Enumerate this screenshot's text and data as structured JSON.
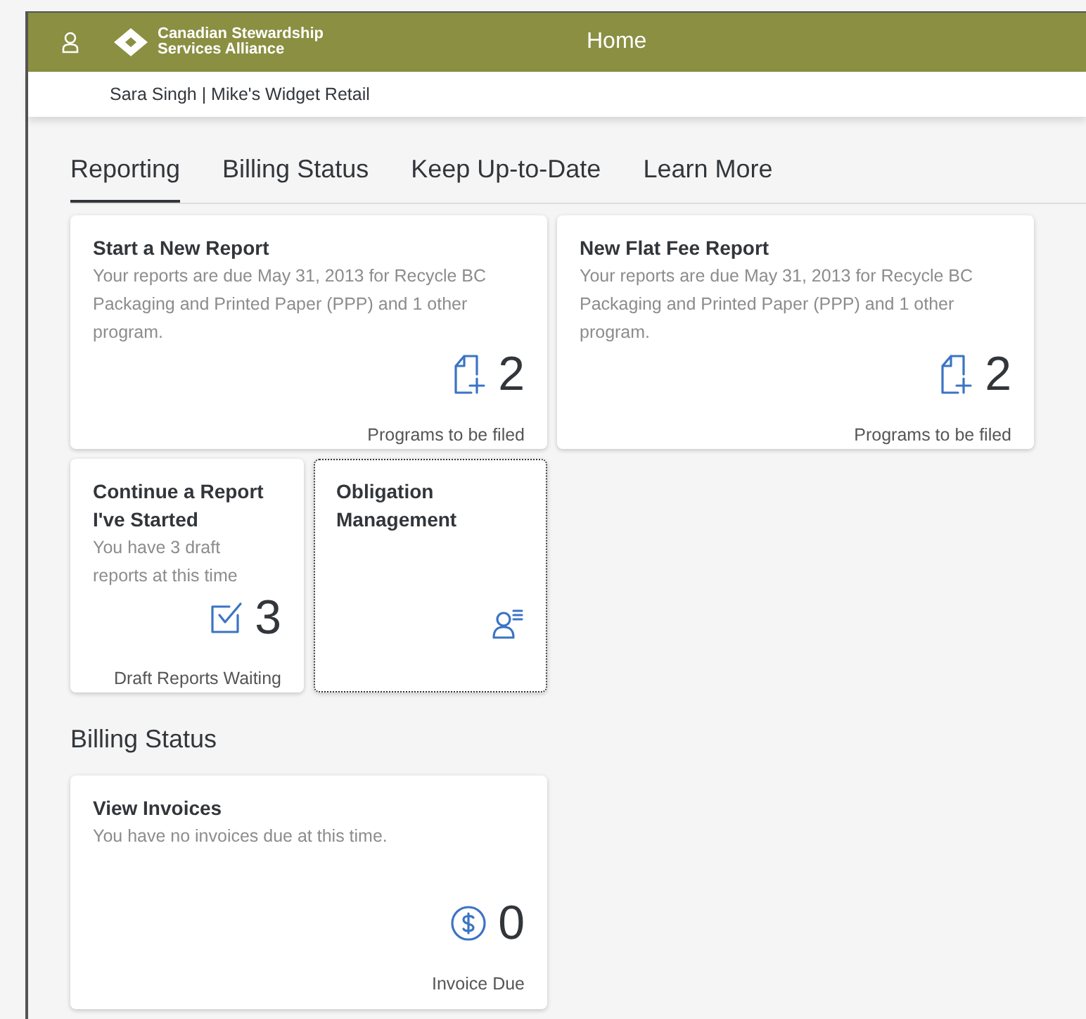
{
  "header": {
    "logo_lines": [
      "Canadian Stewardship",
      "Services Alliance"
    ],
    "title": "Home"
  },
  "user_bar": {
    "text": "Sara Singh | Mike's Widget Retail"
  },
  "tabs": [
    {
      "label": "Reporting",
      "selected": true
    },
    {
      "label": "Billing Status",
      "selected": false
    },
    {
      "label": "Keep Up-to-Date",
      "selected": false
    },
    {
      "label": "Learn More",
      "selected": false
    }
  ],
  "reporting_tiles": [
    {
      "kind": "document",
      "focused": false,
      "title": "Start a New Report",
      "subtitle": "Your reports are due May 31, 2013 for Recycle BC Packaging and Printed Paper (PPP) and 1 other program.",
      "value": "2",
      "footer": "Programs to be filed"
    },
    {
      "kind": "document",
      "focused": false,
      "title": "New Flat Fee Report",
      "subtitle": "Your reports are due May 31, 2013 for Recycle BC Packaging and Printed Paper (PPP) and 1 other program.",
      "value": "2",
      "footer": "Programs to be filed"
    },
    {
      "kind": "checklist",
      "focused": false,
      "title": "Continue a Report I've Started",
      "subtitle": "You have 3 draft reports at this time",
      "value": "3",
      "footer": "Draft Reports Waiting"
    },
    {
      "kind": "people",
      "focused": true,
      "title": "Obligation Management"
    }
  ],
  "billing_section": {
    "heading": "Billing Status",
    "tiles": [
      {
        "kind": "money",
        "focused": false,
        "title": "View Invoices",
        "subtitle": "You have no invoices due at this time.",
        "value": "0",
        "footer": "Invoice Due"
      }
    ]
  }
}
